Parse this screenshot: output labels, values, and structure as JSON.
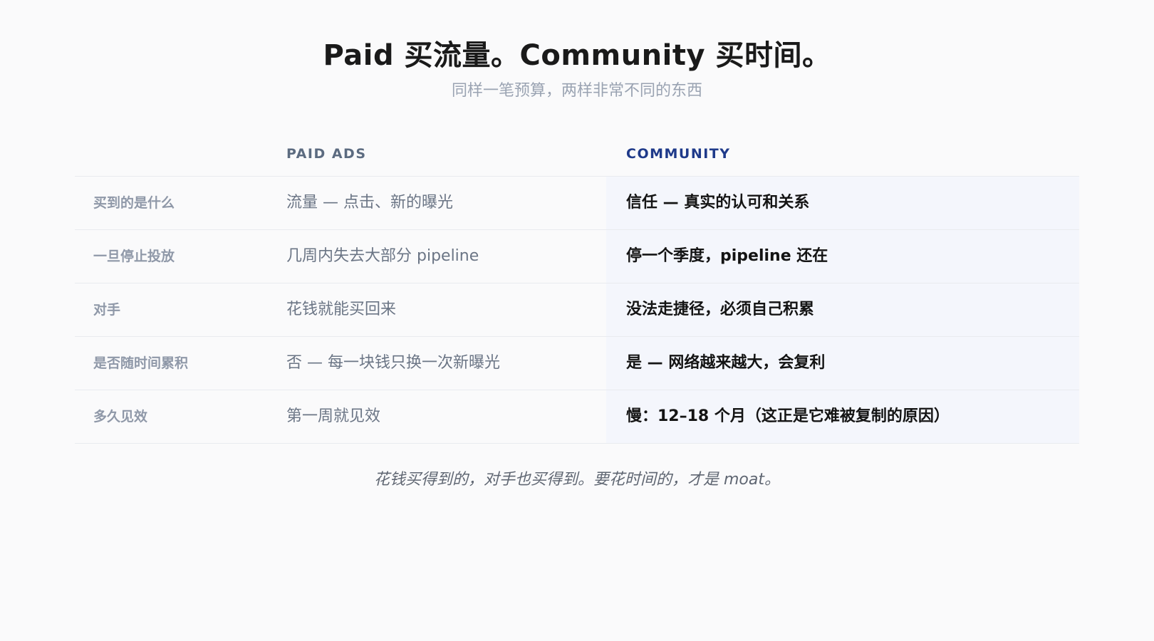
{
  "header": {
    "title": "Paid 买流量。Community 买时间。",
    "subtitle": "同样一笔预算，两样非常不同的东西"
  },
  "table": {
    "columns": {
      "paid": "PAID ADS",
      "community": "COMMUNITY"
    },
    "rows": [
      {
        "label": "买到的是什么",
        "paid": "流量 — 点击、新的曝光",
        "community": "信任 — 真实的认可和关系"
      },
      {
        "label": "一旦停止投放",
        "paid": "几周内失去大部分 pipeline",
        "community": "停一个季度，pipeline 还在"
      },
      {
        "label": "对手",
        "paid": "花钱就能买回来",
        "community": "没法走捷径，必须自己积累"
      },
      {
        "label": "是否随时间累积",
        "paid": "否 — 每一块钱只换一次新曝光",
        "community": "是 — 网络越来越大，会复利"
      },
      {
        "label": "多久见效",
        "paid": "第一周就见效",
        "community": "慢：12–18 个月（这正是它难被复制的原因）"
      }
    ]
  },
  "footnote": "花钱买得到的，对手也买得到。要花时间的，才是 moat。",
  "colors": {
    "background": "#fafafb",
    "community_accent": "#1f3a8a",
    "community_highlight": "#f4f6fc"
  }
}
